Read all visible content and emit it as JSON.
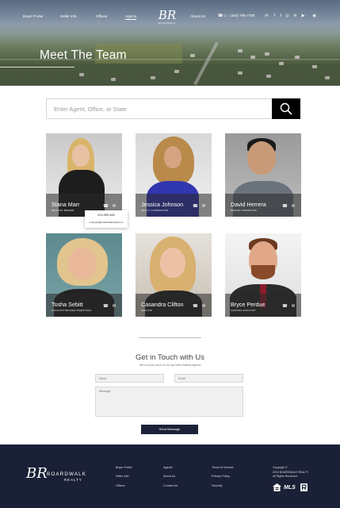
{
  "nav": {
    "links": [
      "Buyer Portal",
      "Seller Info",
      "Offices",
      "Agents",
      "About Us"
    ],
    "active": "Agents",
    "phone": "(404) 795-7786",
    "logo_monogram": "BR",
    "logo_text": "BOARDWALK"
  },
  "hero": {
    "title": "Meet The Team"
  },
  "search": {
    "placeholder": "Enter Agent, Office, or State"
  },
  "agents": [
    {
      "name": "Stana Marr",
      "role": "Realtor, Broker"
    },
    {
      "name": "Jessica Johnson",
      "role": "Realty Coordinator"
    },
    {
      "name": "David Herrera",
      "role": "Broker Operations"
    },
    {
      "name": "Tosha Sebitt",
      "role": "Assistant Broker Operations"
    },
    {
      "name": "Casandra Clifton",
      "role": "Realtor"
    },
    {
      "name": "Bryce Perdue",
      "role": "Showing Assistant"
    }
  ],
  "popup": {
    "phone": "404-555-666",
    "email": "example@boardwalkrealty.com"
  },
  "contact": {
    "title": "Get in Touch with Us",
    "subtitle": "Get to know more of our top rated Atlanta Agents",
    "name_placeholder": "Name",
    "email_placeholder": "Email",
    "message_placeholder": "Message",
    "send_label": "Send Message"
  },
  "footer": {
    "logo_monogram": "BR",
    "logo_name": "BOARDWALK",
    "logo_sub": "REALTY",
    "col1": [
      "Buyer Portal",
      "Seller Info",
      "Offices"
    ],
    "col2": [
      "Agents",
      "About Us",
      "Contact Us"
    ],
    "col3": [
      "Terms of Service",
      "Privacy Policy",
      "Security"
    ],
    "copyright_1": "Copyright ©",
    "copyright_2": "2019 BOARDWALK REALTY.",
    "copyright_3": "All Rights Reserved.",
    "mls": "MLS"
  },
  "colors": {
    "navy": "#1a2035",
    "black": "#000000"
  }
}
